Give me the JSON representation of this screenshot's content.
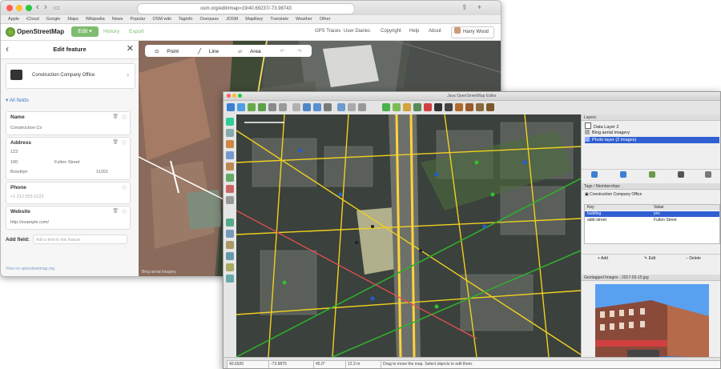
{
  "browser": {
    "url": "osm.org/edit#map=19/40.69237/-73.98743",
    "bookmarks": [
      "Apple",
      "iCloud",
      "Google",
      "Maps",
      "Wikipedia",
      "News",
      "Popular",
      "OSM wiki",
      "Taginfo",
      "Overpass",
      "JOSM",
      "Mapillary",
      "Translate",
      "Weather",
      "Other"
    ],
    "osm": {
      "site_name": "OpenStreetMap",
      "edit_label": "Edit",
      "history_label": "History",
      "export_label": "Export",
      "right_links": [
        "GPS Traces",
        "User Diaries",
        "Copyright",
        "Help",
        "About"
      ],
      "user_name": "Harry Wood",
      "accent": "#7ebc6f"
    },
    "sidebar": {
      "title": "Edit feature",
      "preset": "Construction Company Office",
      "all_fields": "All fields",
      "fields": [
        {
          "label": "Name",
          "value": "Construction Co"
        },
        {
          "label": "Address",
          "value": "123"
        },
        {
          "label": "Phone",
          "value": "+1 212 555 0123"
        },
        {
          "label": "Website",
          "value": "http://example.com/"
        }
      ],
      "address_parts": [
        "100",
        "Fulton Street",
        "Brooklyn",
        "11201"
      ],
      "add_field_label": "Add field:",
      "add_field_placeholder": "Add a field to this feature",
      "footer": "View on openstreetmap.org"
    },
    "map_tools": {
      "point": "Point",
      "line": "Line",
      "area": "Area"
    },
    "map_footer": "Bing aerial imagery"
  },
  "josm": {
    "title": "Java OpenStreetMap Editor",
    "layers_title": "Layers",
    "layers": [
      {
        "name": "Data Layer 2",
        "color": "#ffffff"
      },
      {
        "name": "Bing aerial imagery",
        "color": "#aaaaaa"
      },
      {
        "name": "Photo layer (2 images)",
        "color": "#2f5fd0"
      }
    ],
    "tags_title": "Tags / Memberships",
    "tags_subtitle": "Construction Company Office",
    "tag_headers": [
      "Key",
      "Value"
    ],
    "tags": [
      {
        "key": "building",
        "value": "yes"
      },
      {
        "key": "addr:street",
        "value": "Fulton Street"
      }
    ],
    "tag_buttons": [
      "Add",
      "Edit",
      "Delete"
    ],
    "photo_title": "Geotagged Images - 2017-03-15.jpg",
    "status": {
      "lat": "40.6926",
      "lon": "-73.9875",
      "heading": "45.0°",
      "distance": "12.3 m",
      "message": "Drag to move the map. Select objects to edit them."
    }
  }
}
